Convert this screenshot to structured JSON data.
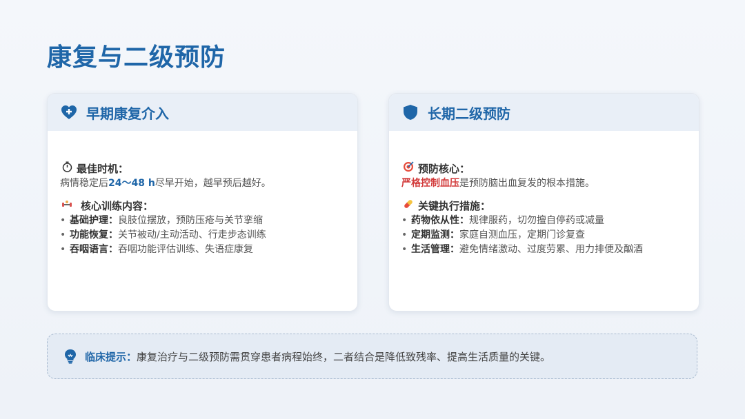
{
  "page": {
    "title": "康复与二级预防"
  },
  "left_card": {
    "header_icon": "heart-plus-icon",
    "title": "早期康复介入",
    "timing": {
      "icon": "stopwatch-icon",
      "heading": "最佳时机：",
      "text_before": "病情稳定后",
      "highlight": "24～48 h",
      "text_after": "尽早开始，越早预后越好。"
    },
    "training": {
      "icon": "dumbbell-icon",
      "heading": "核心训练内容：",
      "items": [
        {
          "label": "基础护理：",
          "text": "良肢位摆放，预防压疮与关节挛缩"
        },
        {
          "label": "功能恢复：",
          "text": "关节被动/主动活动、行走步态训练"
        },
        {
          "label": "吞咽语言：",
          "text": "吞咽功能评估训练、失语症康复"
        }
      ]
    }
  },
  "right_card": {
    "header_icon": "shield-icon",
    "title": "长期二级预防",
    "core": {
      "icon": "target-icon",
      "heading": "预防核心：",
      "highlight": "严格控制血压",
      "text_after": "是预防脑出血复发的根本措施。"
    },
    "measures": {
      "icon": "pill-icon",
      "heading": "关键执行措施：",
      "items": [
        {
          "label": "药物依从性：",
          "text": "规律服药，切勿擅自停药或减量"
        },
        {
          "label": "定期监测：",
          "text": "家庭自测血压，定期门诊复查"
        },
        {
          "label": "生活管理：",
          "text": "避免情绪激动、过度劳累、用力排便及酗酒"
        }
      ]
    }
  },
  "tip": {
    "icon": "lightbulb-icon",
    "label": "临床提示：",
    "text": "康复治疗与二级预防需贯穿患者病程始终，二者结合是降低致残率、提高生活质量的关键。"
  },
  "colors": {
    "accent": "#1f66a8",
    "highlight_red": "#d23b3b",
    "card_header_bg": "#e9eff7"
  }
}
